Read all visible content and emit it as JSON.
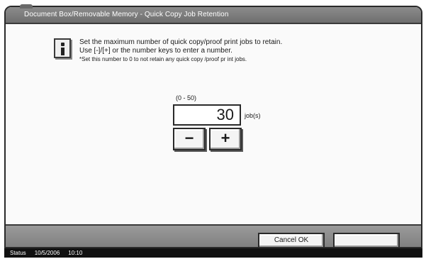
{
  "window": {
    "title": "Document Box/Removable Memory - Quick Copy Job Retention"
  },
  "message": {
    "icon": "info-icon",
    "line1": "Set the maximum number of quick copy/proof print jobs to retain.",
    "line2": "Use [-]/[+] or the number keys to enter a number.",
    "line3": "*Set this number to 0 to not retain any quick copy /proof pr int jobs."
  },
  "setting": {
    "range_label": "(0 - 50)",
    "value": "30",
    "unit": "job(s)",
    "minus_label": "−",
    "plus_label": "+"
  },
  "footer": {
    "cancel_ok_label": "Cancel OK",
    "blank_button_label": ""
  },
  "status": {
    "label": "Status",
    "date": "10/5/2006",
    "time": "10:10"
  }
}
